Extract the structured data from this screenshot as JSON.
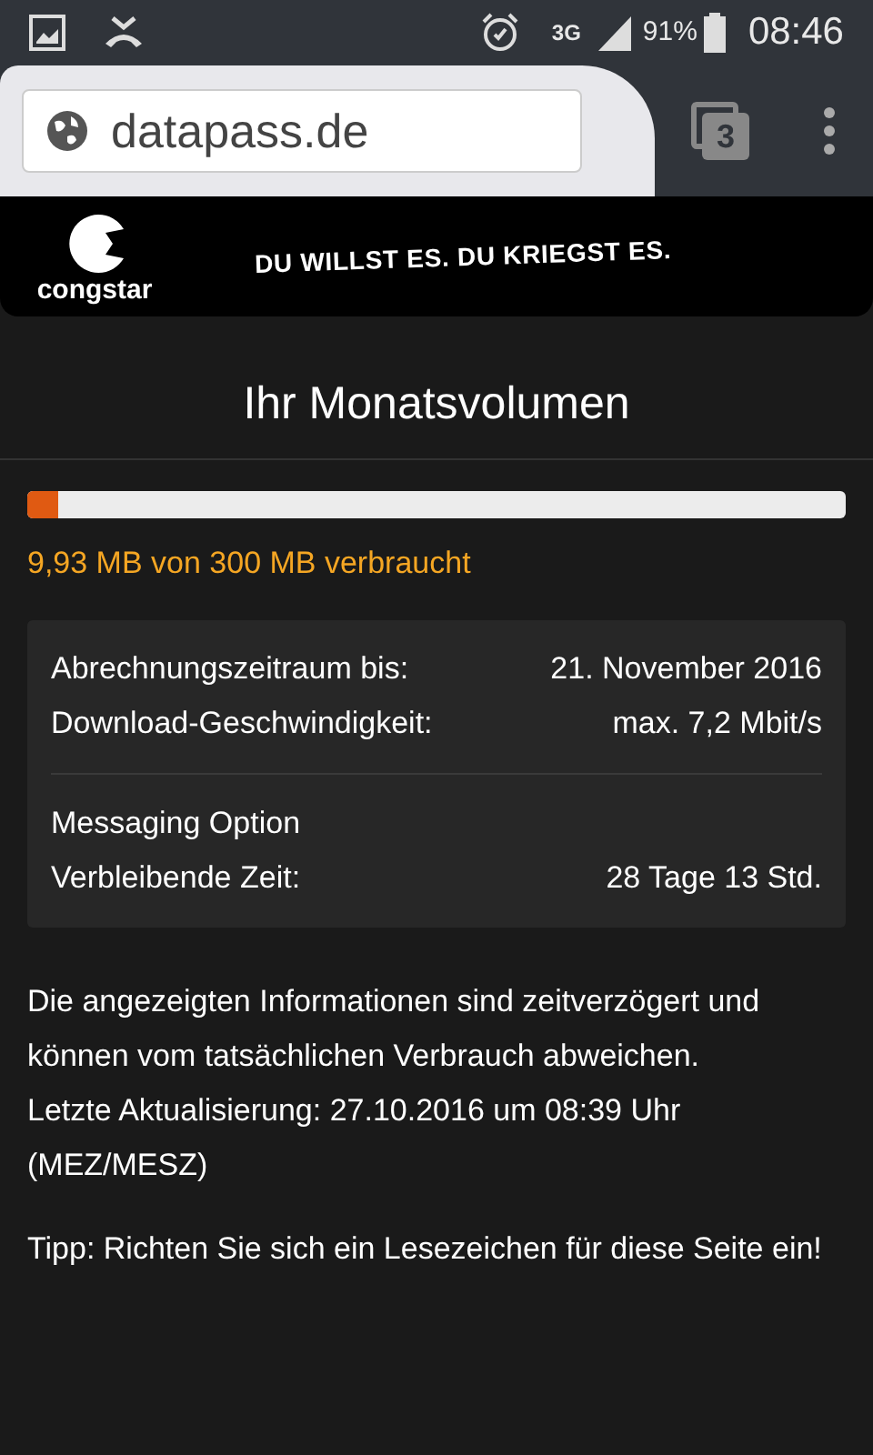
{
  "status_bar": {
    "network": "3G",
    "battery": "91%",
    "time": "08:46"
  },
  "browser": {
    "url": "datapass.de",
    "tab_count": "3"
  },
  "banner": {
    "logo_text": "congstar",
    "slogan": "DU WILLST ES. DU KRIEGST ES."
  },
  "title": "Ihr Monatsvolumen",
  "usage": {
    "level": 0.037,
    "text": "9,93 MB von 300 MB verbraucht"
  },
  "details": {
    "rows": [
      {
        "label": "Abrechnungszeitraum bis:",
        "value": "21. November 2016"
      },
      {
        "label": "Download-Geschwindigkeit:",
        "value": "max. 7,2 Mbit/s"
      }
    ],
    "option": {
      "title": "Messaging Option",
      "label": "Verbleibende Zeit:",
      "value": "28 Tage 13 Std."
    }
  },
  "info": [
    "Die angezeigten Informationen sind zeitverzögert und können vom tatsächlichen Verbrauch abweichen.",
    "Letzte Aktualisierung: 27.10.2016 um 08:39 Uhr (MEZ/MESZ)"
  ],
  "tip": "Tipp: Richten Sie sich ein Lesezeichen für diese Seite ein!"
}
